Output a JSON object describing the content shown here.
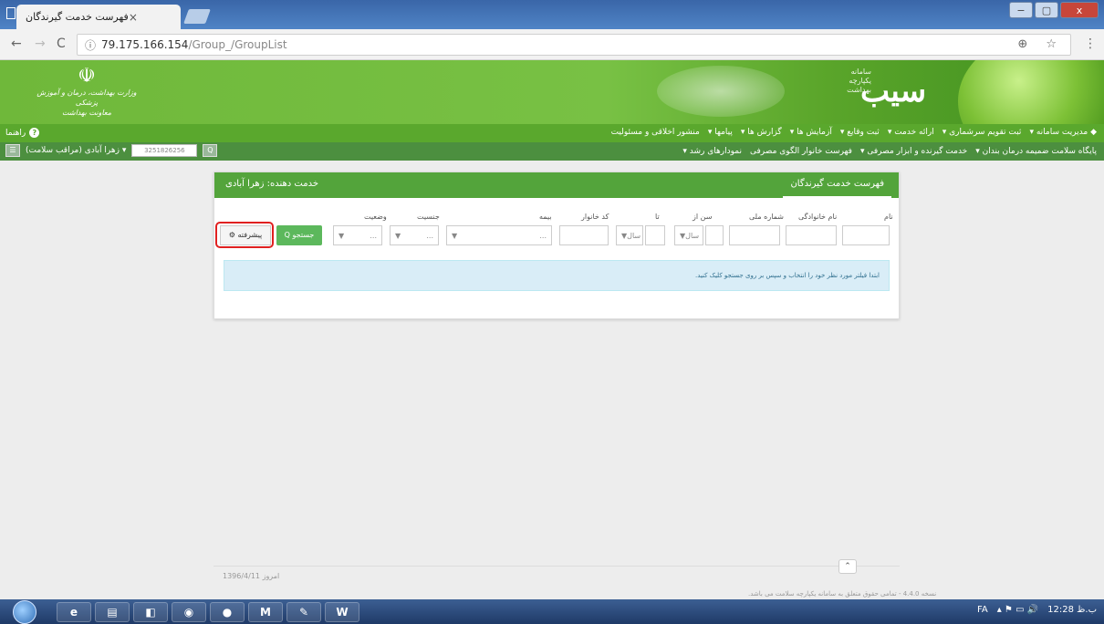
{
  "browser": {
    "tab_title": "فهرست خدمت گیرندگان",
    "tab_close": "×",
    "url_host": "79.175.166.154",
    "url_path": "/Group_/GroupList",
    "info_icon": "ⓘ",
    "back_glyph": "←",
    "forward_glyph": "→",
    "reload_glyph": "C",
    "toolbar_icons": "⊕ ☆",
    "menu_glyph": "⋮",
    "window_buttons": {
      "minimize": "−",
      "maximize": "▢",
      "close": "x"
    }
  },
  "header": {
    "emblem_symbol": "☫",
    "emblem_line1": "وزارت بهداشت، درمان و آموزش پزشکی",
    "emblem_line2": "معاونت بهداشت",
    "brand_small": "سامانه یکپارچه بهداشت",
    "brand_big": "سیب"
  },
  "menu1": {
    "items": [
      "◆ مدیریت سامانه ▾",
      "ثبت تقویم سرشماری ▾",
      "ارائه خدمت ▾",
      "ثبت وقایع ▾",
      "آزمایش ها ▾",
      "گزارش ها ▾",
      "پیامها ▾",
      "منشور اخلاقی و مسئولیت"
    ],
    "help_label": "راهنما",
    "help_icon": "?"
  },
  "menu2": {
    "items": [
      "پایگاه سلامت ضمیمه درمان بندان ▾",
      "خدمت گیرنده و ابزار مصرفی ▾",
      "فهرست خانوار الگوی مصرفی",
      "نمودارهای رشد ▾"
    ],
    "user_label": "زهرا آبادی (مراقب سلامت) ▾",
    "code_value": "3251826256",
    "search_icon": "Q",
    "toggle_icon": "☰"
  },
  "panel": {
    "tab_right": "فهرست خدمت گیرندگان",
    "tab_left": "خدمت دهنده: زهرا آبادی",
    "labels": {
      "name": "نام",
      "family": "نام خانوادگی",
      "national_id": "شماره ملی",
      "age_from": "سن از",
      "age_to": "تا",
      "household_code": "کد خانوار",
      "insurance": "بیمه",
      "gender": "جنسیت",
      "status": "وضعیت"
    },
    "age_unit": "سال",
    "select_placeholder": "...",
    "search_button": "Q جستجو",
    "advanced_button": "⚙ پیشرفته",
    "alert": "ابتدا فیلتر مورد نظر خود را انتخاب و سپس بر روی جستجو کلیک کنید."
  },
  "footer": {
    "date": "امروز 1396/4/11",
    "scroll_up": "⌃",
    "status": "نسخه 4.4.0 - تمامی حقوق متعلق به سامانه یکپارچه سلامت می باشد."
  },
  "taskbar": {
    "apps": [
      "e",
      "▤",
      "◧",
      "◉",
      "●",
      "M",
      "✎",
      "W"
    ],
    "lang": "FA",
    "tray_icons": "▴ ⚑ ▭ 🔊",
    "time": "12:28 ب.ظ"
  }
}
